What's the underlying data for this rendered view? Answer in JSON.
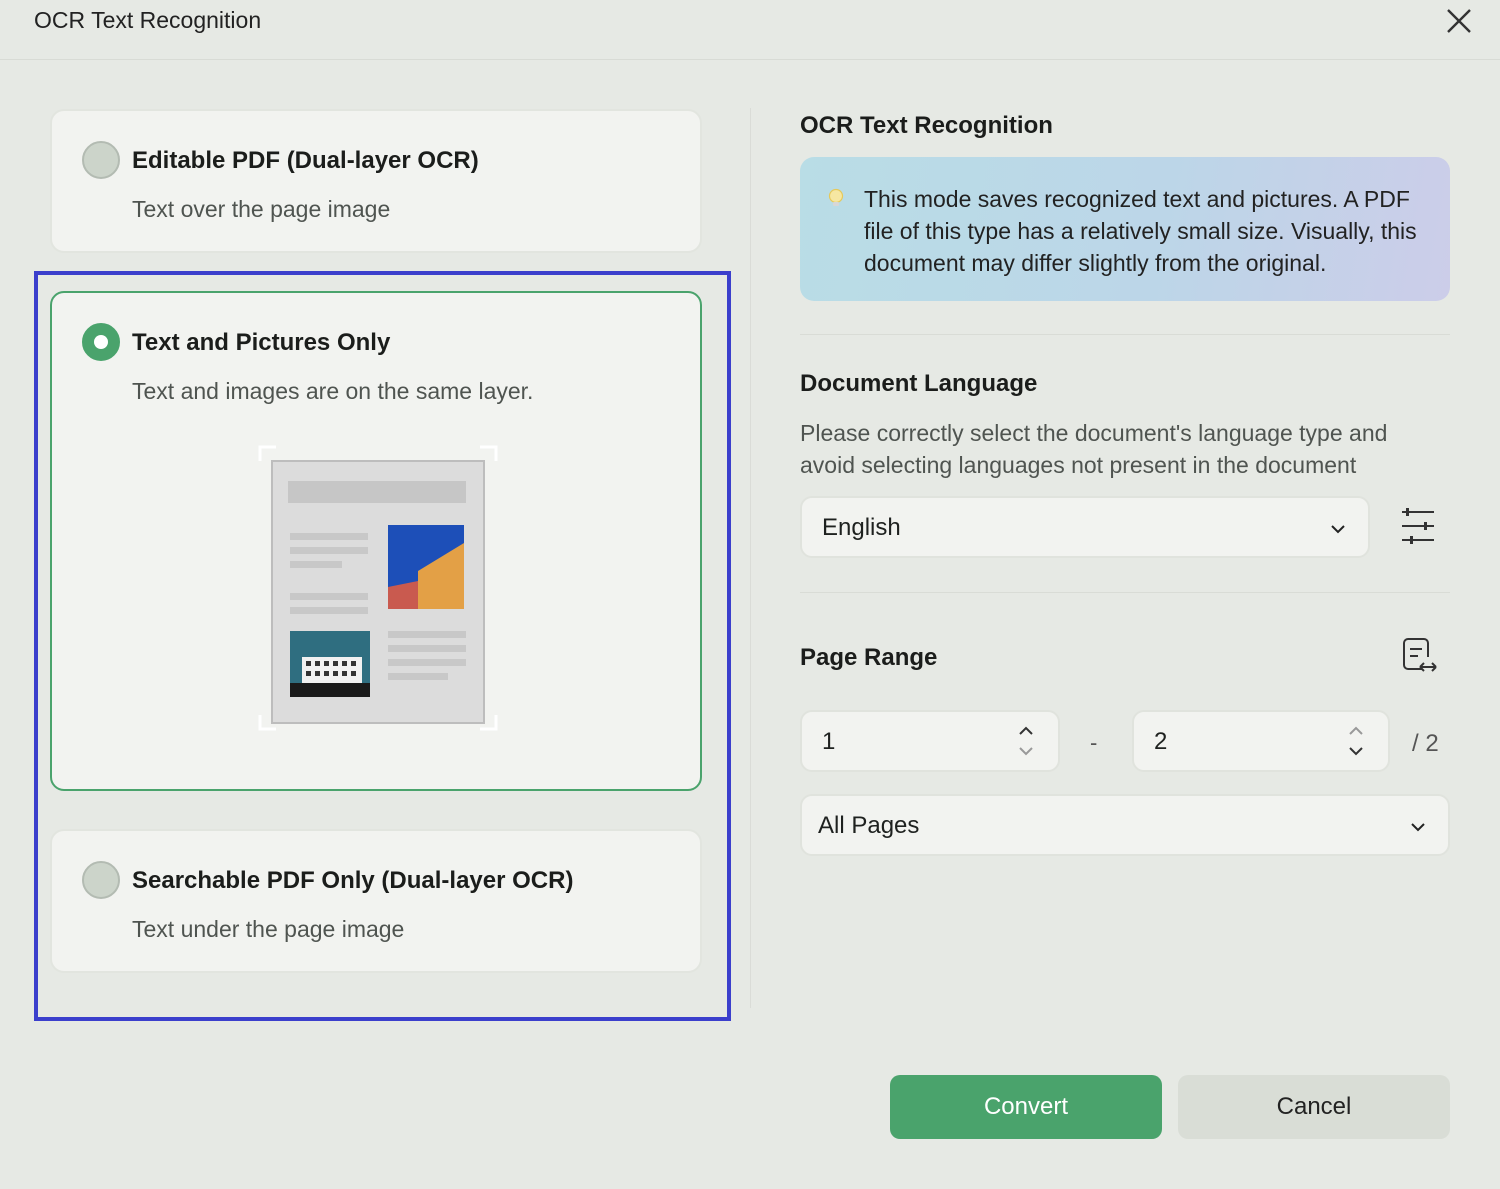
{
  "dialog": {
    "title": "OCR Text Recognition"
  },
  "options": [
    {
      "title": "Editable PDF (Dual-layer OCR)",
      "subtitle": "Text over the page image",
      "selected": false
    },
    {
      "title": "Text and Pictures Only",
      "subtitle": "Text and images are on the same layer.",
      "selected": true
    },
    {
      "title": "Searchable PDF Only (Dual-layer OCR)",
      "subtitle": "Text under the page image",
      "selected": false
    }
  ],
  "right": {
    "ocr_title": "OCR Text Recognition",
    "info_text": "This mode saves recognized text and pictures. A PDF file of this type has a relatively small size. Visually, this document may differ slightly from the original.",
    "language_title": "Document Language",
    "language_hint": "Please correctly select the document's language type and avoid selecting languages not present in the document",
    "language_value": "English",
    "page_range_title": "Page Range",
    "page_from": "1",
    "page_separator": "-",
    "page_to": "2",
    "page_total": "/ 2",
    "page_scope": "All Pages"
  },
  "buttons": {
    "convert": "Convert",
    "cancel": "Cancel"
  },
  "colors": {
    "accent": "#4aa36c",
    "highlight": "#3b3fcc",
    "background": "#e6e9e4"
  }
}
